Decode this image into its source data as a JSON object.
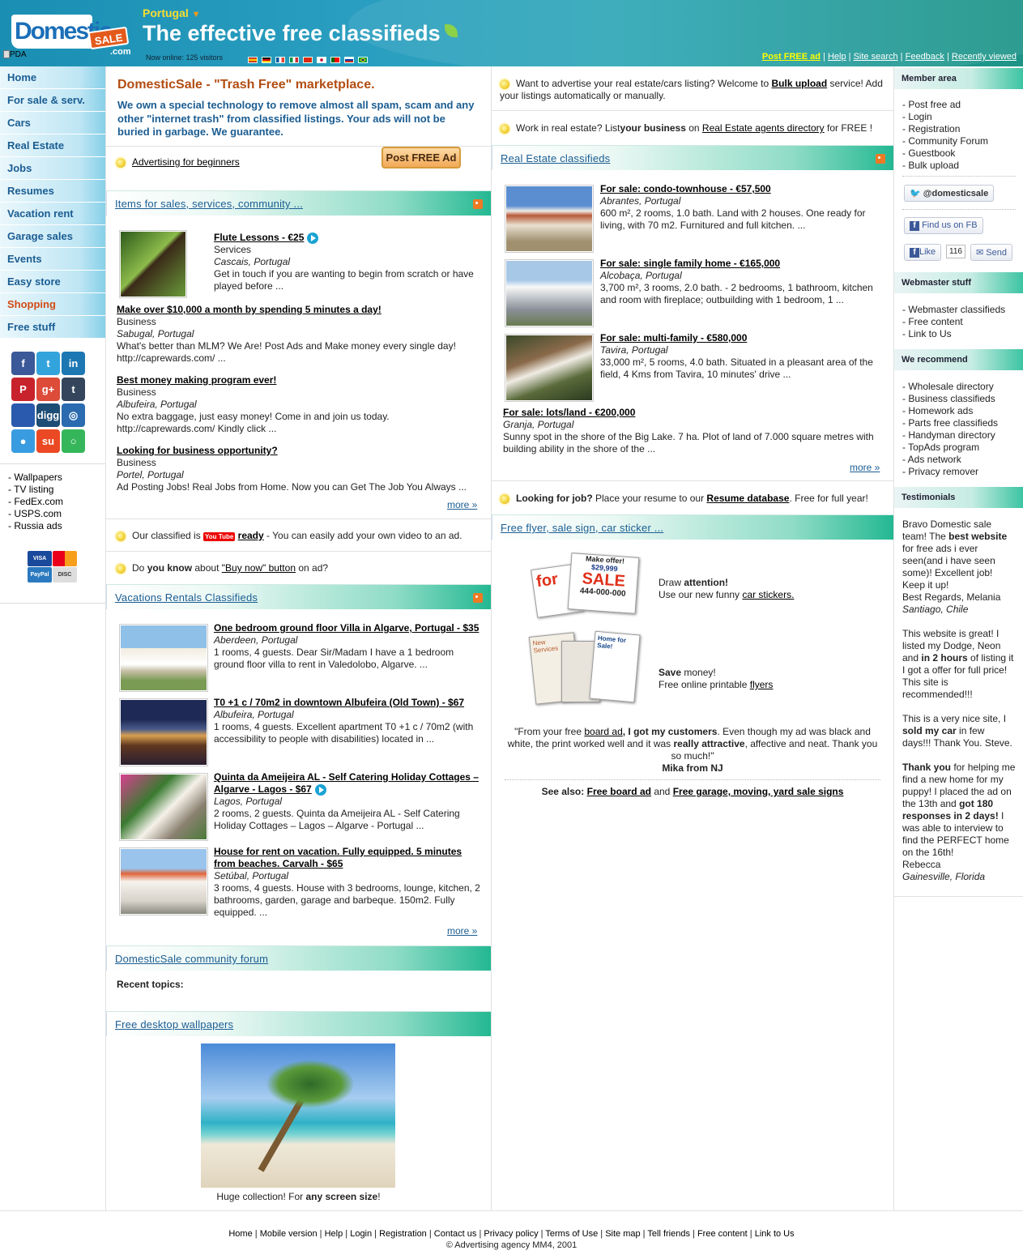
{
  "header": {
    "logo_main": "Domestic",
    "logo_badge": "SALE",
    "logo_suffix": ".com",
    "pda": "PDA",
    "country": "Portugal",
    "slogan": "The effective free classifieds",
    "online": "Now online: 125 visitors",
    "links": [
      {
        "label": "Post FREE ad",
        "highlight": true
      },
      {
        "label": "Help"
      },
      {
        "label": "Site search"
      },
      {
        "label": "Feedback"
      },
      {
        "label": "Recently viewed"
      }
    ]
  },
  "nav": [
    "Home",
    "For sale & serv.",
    "Cars",
    "Real Estate",
    "Jobs",
    "Resumes",
    "Vacation rent",
    "Garage sales",
    "Events",
    "Easy store",
    "Shopping",
    "Free stuff"
  ],
  "social": [
    {
      "icon": "facebook-icon",
      "g": "f",
      "c": "#3b5998"
    },
    {
      "icon": "twitter-icon",
      "g": "t",
      "c": "#33a3dc"
    },
    {
      "icon": "linkedin-icon",
      "g": "in",
      "c": "#1d77b3"
    },
    {
      "icon": "pinterest-icon",
      "g": "P",
      "c": "#c8232c"
    },
    {
      "icon": "googleplus-icon",
      "g": "g+",
      "c": "#dd4b39"
    },
    {
      "icon": "tumblr-icon",
      "g": "t",
      "c": "#35465c"
    },
    {
      "icon": "delicious-icon",
      "g": "",
      "c": "#2a5aad"
    },
    {
      "icon": "digg-icon",
      "g": "digg",
      "c": "#1d4c74"
    },
    {
      "icon": "newsvine-icon",
      "g": "◎",
      "c": "#2b6bb0"
    },
    {
      "icon": "reddit-icon",
      "g": "●",
      "c": "#3a9ce0"
    },
    {
      "icon": "stumbleupon-icon",
      "g": "su",
      "c": "#eb4923"
    },
    {
      "icon": "chat-icon",
      "g": "○",
      "c": "#36b65a"
    }
  ],
  "left_links": [
    "- Wallpapers",
    "- TV listing",
    "- FedEx.com",
    "- USPS.com",
    "- Russia ads"
  ],
  "colA": {
    "intro_title": "DomesticSale - \"Trash Free\" marketplace.",
    "intro_text": "We own a special technology to remove almost all spam, scam and any other \"internet trash\" from classified listings. Your ads will not be buried in garbage. We guarantee.",
    "adv_beginners": "Advertising for beginners",
    "post_btn": "Post FREE Ad",
    "items_title": "Items for sales, services, community ...",
    "items": [
      {
        "title": "Flute Lessons - €25",
        "cat": "Services",
        "loc": "Cascais, Portugal",
        "desc": "Get in touch if you are wanting to begin from scratch or have played before ..."
      },
      {
        "title": "Make over $10,000 a month by spending 5 minutes a day!",
        "cat": "Business",
        "loc": "Sabugal, Portugal",
        "desc": "What's better than MLM? We Are! Post Ads and Make money every single day! http://caprewards.com/ ..."
      },
      {
        "title": "Best money making program ever!",
        "cat": "Business",
        "loc": "Albufeira, Portugal",
        "desc": "No extra baggage, just easy money! Come in and join us today. http://caprewards.com/ Kindly click ..."
      },
      {
        "title": "Looking for business opportunity?",
        "cat": "Business",
        "loc": "Portel, Portugal",
        "desc": "Ad Posting Jobs! Real Jobs from Home. Now you can Get The Job You Always ..."
      }
    ],
    "more": "more »",
    "yt_pre": "Our classified is",
    "yt_logo": "You Tube",
    "yt_ready": "ready",
    "yt_post": "- You can easily add your own video to an ad.",
    "buynow_pre": "Do",
    "buynow_b": "you know",
    "buynow_mid": "about",
    "buynow_link": "\"Buy now\" button",
    "buynow_post": "on ad?",
    "vac_title": "Vacations Rentals Classifieds",
    "vac": [
      {
        "title": "One bedroom ground floor Villa in Algarve, Portugal - $35",
        "loc": "Aberdeen, Portugal",
        "desc": "1 rooms, 4 guests. Dear Sir/Madam I have a 1 bedroom ground floor villa to rent in Valedolobo, Algarve. ..."
      },
      {
        "title": "T0 +1 c / 70m2 in downtown Albufeira (Old Town) - $67",
        "loc": "Albufeira, Portugal",
        "desc": "1 rooms, 4 guests. Excellent apartment T0 +1 c / 70m2 (with accessibility to people with disabilities) located in ..."
      },
      {
        "title": "Quinta da Ameijeira AL - Self Catering Holiday Cottages – Algarve - Lagos - $67",
        "loc": "Lagos, Portugal",
        "desc": "2 rooms, 2 guests. Quinta da Ameijeira AL - Self Catering Holiday Cottages – Lagos – Algarve - Portugal ..."
      },
      {
        "title": "House for rent on vacation. Fully equipped. 5 minutes from beaches. Carvalh - $65",
        "loc": "Setúbal, Portugal",
        "desc": "3 rooms, 4 guests. House with 3 bedrooms, lounge, kitchen, 2 bathrooms, garden, garage and barbeque. 150m2. Fully equipped. ..."
      }
    ],
    "forum_title": "DomesticSale community forum",
    "recent": "Recent topics:",
    "wall_title": "Free desktop wallpapers",
    "wall_cap_pre": "Huge collection! For",
    "wall_cap_b": "any screen size",
    "wall_cap_post": "!"
  },
  "colB": {
    "bulk_pre": "Want to advertise your real estate/cars listing? Welcome to",
    "bulk_link": "Bulk upload",
    "bulk_post": "service! Add your listings automatically or manually.",
    "agent_pre": "Work in real estate? List",
    "agent_b": "your business",
    "agent_mid": "on",
    "agent_link": "Real Estate agents directory",
    "agent_post": "for FREE !",
    "re_title": "Real Estate classifieds",
    "re": [
      {
        "title": "For sale: condo-townhouse - €57,500",
        "loc": "Abrantes, Portugal",
        "desc": "600 m², 2 rooms, 1.0 bath. Land with 2 houses. One ready for living, with 70 m2. Furnitured and full kitchen. ..."
      },
      {
        "title": "For sale: single family home - €165,000",
        "loc": "Alcobaça, Portugal",
        "desc": "3,700 m², 3 rooms, 2.0 bath. - 2 bedrooms, 1 bathroom, kitchen and room with fireplace; outbuilding with 1 bedroom, 1 ..."
      },
      {
        "title": "For sale: multi-family - €580,000",
        "loc": "Tavira, Portugal",
        "desc": "33,000 m², 5 rooms, 4.0 bath. Situated in a pleasant area of the field, 4 Kms from Tavira, 10 minutes' drive ..."
      },
      {
        "title": "For sale: lots/land - €200,000",
        "loc": "Granja, Portugal",
        "desc": "Sunny spot in the shore of the Big Lake. 7 ha. Plot of land of 7.000 square metres with building ability in the shore of the ..."
      }
    ],
    "more": "more »",
    "job_b": "Looking for job?",
    "job_pre": "Place your resume to our",
    "job_link": "Resume database",
    "job_post": ". Free for full year!",
    "flyer_title": "Free flyer, sale sign, car sticker ...",
    "sticker_text1": "Make offer!",
    "sticker_price": "$29,999",
    "sticker_for": "for",
    "sticker_sale": "SALE",
    "sticker_phone": "444-000-000",
    "draw_pre": "Draw",
    "draw_b": "attention!",
    "draw_line2": "Use our new funny",
    "draw_link": "car stickers.",
    "flyer_news": "New Services",
    "flyer_home": "Home for Sale!",
    "save_b": "Save",
    "save_post": "money!",
    "save_line2": "Free online printable",
    "save_link": "flyers",
    "quote_a": "\"From your free",
    "quote_link": "board ad",
    "quote_b": ", I got my customers",
    "quote_c": ". Even though my ad was black and white, the print worked well and it was",
    "quote_d": "really attractive",
    "quote_e": ", affective and neat. Thank you so much!\"",
    "quote_author": "Mika from NJ",
    "see_also": "See also:",
    "see_link1": "Free board ad",
    "see_and": "and",
    "see_link2": "Free garage, moving, yard sale signs"
  },
  "right": {
    "member_title": "Member area",
    "member": [
      "- Post free ad",
      "- Login",
      "- Registration",
      "- Community Forum",
      "- Guestbook",
      "- Bulk upload"
    ],
    "twitter": "@domesticsale",
    "fb_find": "Find us on FB",
    "fb_like": "Like",
    "fb_count": "116",
    "fb_send": "Send",
    "web_title": "Webmaster stuff",
    "web": [
      "- Webmaster classifieds",
      "- Free content",
      "- Link to Us"
    ],
    "rec_title": "We recommend",
    "rec": [
      "- Wholesale directory",
      "- Business classifieds",
      "- Homework ads",
      "- Parts free classifieds",
      "- Handyman directory",
      "- TopAds program",
      "- Ads network",
      "- Privacy remover"
    ],
    "test_title": "Testimonials"
  },
  "footer": {
    "links": [
      "Home",
      "Mobile version",
      "Help",
      "Login",
      "Registration",
      "Contact us",
      "Privacy policy",
      "Terms of Use",
      "Site map",
      "Tell friends",
      "Free content",
      "Link to Us"
    ],
    "copy": "© Advertising agency MM4, 2001"
  }
}
